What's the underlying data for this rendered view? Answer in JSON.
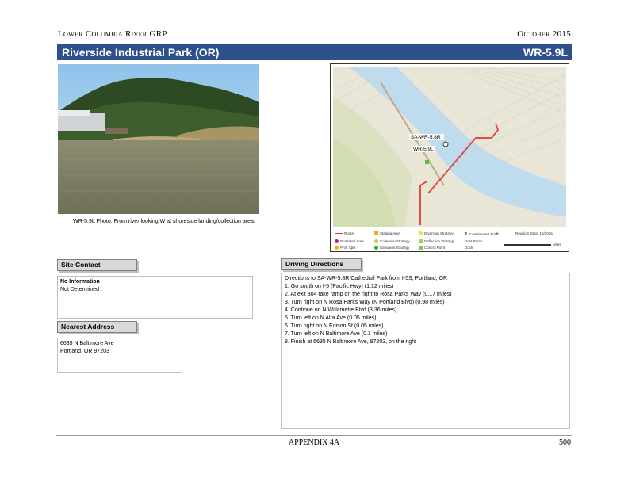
{
  "header": {
    "left": "Lower Columbia River GRP",
    "right": "October 2015"
  },
  "title": {
    "site_name": "Riverside Industrial Park (OR)",
    "site_code": "WR-5.9L"
  },
  "photo": {
    "caption": "WR-5.9L Photo: From river looking W at shoreside landing/collection area."
  },
  "map": {
    "labels": {
      "site_a": "SA-WR-5.8R",
      "site_b": "WR-5.9L"
    },
    "legend": {
      "items": [
        "Route",
        "Protected Area",
        "Prot. Spill",
        "Staging Area",
        "Collection Strategy",
        "Exclusion Strategy",
        "Diversion Strategy",
        "Deflection Strategy",
        "Control Point",
        "Containment Point",
        "Boat Ramp",
        "Dock"
      ],
      "info": "Revision Date: 10/2015",
      "scale": "Miles"
    },
    "colors": {
      "water": "#bcd8ea",
      "land": "#e7e3d4",
      "route": "#e03c31"
    }
  },
  "site_contact": {
    "label": "Site Contact",
    "name": "No Information",
    "detail": "Not Determined :"
  },
  "nearest_address": {
    "label": "Nearest Address",
    "line1": "6635 N Baltimore Ave",
    "line2": "Portland, OR 97203"
  },
  "driving_directions": {
    "label": "Driving Directions",
    "intro": "Directions to SA-WR-5.8R Cathedral Park from I-5S, Portland, OR",
    "steps": [
      "1. Go south on I-5 (Pacific Hwy) (1.12 miles)",
      "2. At exit 304 take ramp on the right to Rosa Parks Way (0.17 miles)",
      "3. Turn right on N Rosa Parks Way (N Portland Blvd) (0.98 miles)",
      "4. Continue on N Willamette Blvd (3.36 miles)",
      "5. Turn left on N Alta Ave (0.05 miles)",
      "6. Turn right on N Edison St (0.05 miles)",
      "7. Turn left on N Baltimore Ave (0.1 miles)",
      "8. Finish at 6635 N Baltimore Ave, 97203, on the right"
    ]
  },
  "footer": {
    "center": "APPENDIX 4A",
    "page": "500"
  }
}
